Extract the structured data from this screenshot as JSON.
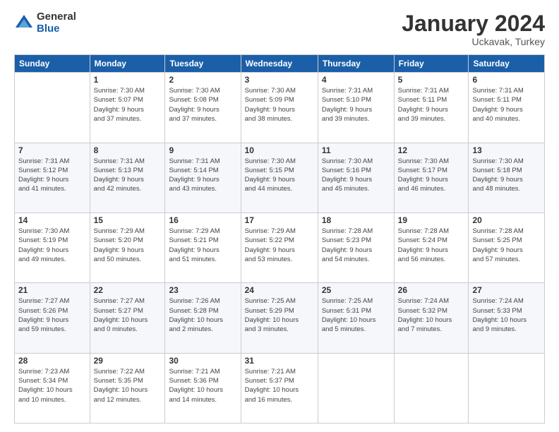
{
  "logo": {
    "general": "General",
    "blue": "Blue"
  },
  "title": {
    "month_year": "January 2024",
    "location": "Uckavak, Turkey"
  },
  "weekdays": [
    "Sunday",
    "Monday",
    "Tuesday",
    "Wednesday",
    "Thursday",
    "Friday",
    "Saturday"
  ],
  "weeks": [
    [
      {
        "day": "",
        "info": ""
      },
      {
        "day": "1",
        "info": "Sunrise: 7:30 AM\nSunset: 5:07 PM\nDaylight: 9 hours\nand 37 minutes."
      },
      {
        "day": "2",
        "info": "Sunrise: 7:30 AM\nSunset: 5:08 PM\nDaylight: 9 hours\nand 37 minutes."
      },
      {
        "day": "3",
        "info": "Sunrise: 7:30 AM\nSunset: 5:09 PM\nDaylight: 9 hours\nand 38 minutes."
      },
      {
        "day": "4",
        "info": "Sunrise: 7:31 AM\nSunset: 5:10 PM\nDaylight: 9 hours\nand 39 minutes."
      },
      {
        "day": "5",
        "info": "Sunrise: 7:31 AM\nSunset: 5:11 PM\nDaylight: 9 hours\nand 39 minutes."
      },
      {
        "day": "6",
        "info": "Sunrise: 7:31 AM\nSunset: 5:11 PM\nDaylight: 9 hours\nand 40 minutes."
      }
    ],
    [
      {
        "day": "7",
        "info": "Sunrise: 7:31 AM\nSunset: 5:12 PM\nDaylight: 9 hours\nand 41 minutes."
      },
      {
        "day": "8",
        "info": "Sunrise: 7:31 AM\nSunset: 5:13 PM\nDaylight: 9 hours\nand 42 minutes."
      },
      {
        "day": "9",
        "info": "Sunrise: 7:31 AM\nSunset: 5:14 PM\nDaylight: 9 hours\nand 43 minutes."
      },
      {
        "day": "10",
        "info": "Sunrise: 7:30 AM\nSunset: 5:15 PM\nDaylight: 9 hours\nand 44 minutes."
      },
      {
        "day": "11",
        "info": "Sunrise: 7:30 AM\nSunset: 5:16 PM\nDaylight: 9 hours\nand 45 minutes."
      },
      {
        "day": "12",
        "info": "Sunrise: 7:30 AM\nSunset: 5:17 PM\nDaylight: 9 hours\nand 46 minutes."
      },
      {
        "day": "13",
        "info": "Sunrise: 7:30 AM\nSunset: 5:18 PM\nDaylight: 9 hours\nand 48 minutes."
      }
    ],
    [
      {
        "day": "14",
        "info": "Sunrise: 7:30 AM\nSunset: 5:19 PM\nDaylight: 9 hours\nand 49 minutes."
      },
      {
        "day": "15",
        "info": "Sunrise: 7:29 AM\nSunset: 5:20 PM\nDaylight: 9 hours\nand 50 minutes."
      },
      {
        "day": "16",
        "info": "Sunrise: 7:29 AM\nSunset: 5:21 PM\nDaylight: 9 hours\nand 51 minutes."
      },
      {
        "day": "17",
        "info": "Sunrise: 7:29 AM\nSunset: 5:22 PM\nDaylight: 9 hours\nand 53 minutes."
      },
      {
        "day": "18",
        "info": "Sunrise: 7:28 AM\nSunset: 5:23 PM\nDaylight: 9 hours\nand 54 minutes."
      },
      {
        "day": "19",
        "info": "Sunrise: 7:28 AM\nSunset: 5:24 PM\nDaylight: 9 hours\nand 56 minutes."
      },
      {
        "day": "20",
        "info": "Sunrise: 7:28 AM\nSunset: 5:25 PM\nDaylight: 9 hours\nand 57 minutes."
      }
    ],
    [
      {
        "day": "21",
        "info": "Sunrise: 7:27 AM\nSunset: 5:26 PM\nDaylight: 9 hours\nand 59 minutes."
      },
      {
        "day": "22",
        "info": "Sunrise: 7:27 AM\nSunset: 5:27 PM\nDaylight: 10 hours\nand 0 minutes."
      },
      {
        "day": "23",
        "info": "Sunrise: 7:26 AM\nSunset: 5:28 PM\nDaylight: 10 hours\nand 2 minutes."
      },
      {
        "day": "24",
        "info": "Sunrise: 7:25 AM\nSunset: 5:29 PM\nDaylight: 10 hours\nand 3 minutes."
      },
      {
        "day": "25",
        "info": "Sunrise: 7:25 AM\nSunset: 5:31 PM\nDaylight: 10 hours\nand 5 minutes."
      },
      {
        "day": "26",
        "info": "Sunrise: 7:24 AM\nSunset: 5:32 PM\nDaylight: 10 hours\nand 7 minutes."
      },
      {
        "day": "27",
        "info": "Sunrise: 7:24 AM\nSunset: 5:33 PM\nDaylight: 10 hours\nand 9 minutes."
      }
    ],
    [
      {
        "day": "28",
        "info": "Sunrise: 7:23 AM\nSunset: 5:34 PM\nDaylight: 10 hours\nand 10 minutes."
      },
      {
        "day": "29",
        "info": "Sunrise: 7:22 AM\nSunset: 5:35 PM\nDaylight: 10 hours\nand 12 minutes."
      },
      {
        "day": "30",
        "info": "Sunrise: 7:21 AM\nSunset: 5:36 PM\nDaylight: 10 hours\nand 14 minutes."
      },
      {
        "day": "31",
        "info": "Sunrise: 7:21 AM\nSunset: 5:37 PM\nDaylight: 10 hours\nand 16 minutes."
      },
      {
        "day": "",
        "info": ""
      },
      {
        "day": "",
        "info": ""
      },
      {
        "day": "",
        "info": ""
      }
    ]
  ]
}
